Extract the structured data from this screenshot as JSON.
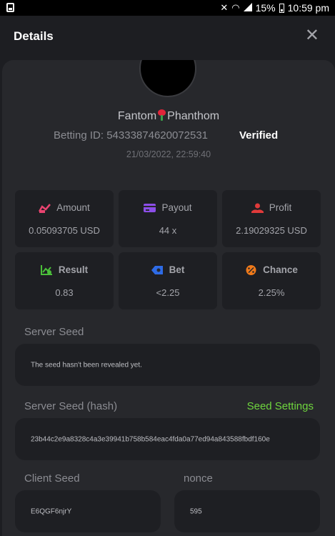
{
  "statusbar": {
    "battery": "15%",
    "time": "10:59 pm"
  },
  "header": {
    "title": "Details",
    "close_symbol": "✕"
  },
  "user": {
    "name_part1": "Fantom",
    "name_part2": "Phanthom",
    "betting_id": "Betting ID: 54333874620072531",
    "verified": "Verified",
    "datetime": "21/03/2022, 22:59:40"
  },
  "stats": {
    "amount": {
      "label": "Amount",
      "value": "0.05093705 USD",
      "color": "#e8436f"
    },
    "payout": {
      "label": "Payout",
      "value": "44 x",
      "color": "#8c4ee8"
    },
    "profit": {
      "label": "Profit",
      "value": "2.19029325 USD",
      "color": "#e03a3a"
    },
    "result": {
      "label": "Result",
      "value": "0.83",
      "color": "#4bbf3a"
    },
    "bet": {
      "label": "Bet",
      "value": "<2.25",
      "color": "#2e6be6"
    },
    "chance": {
      "label": "Chance",
      "value": "2.25%",
      "color": "#f07a1a"
    }
  },
  "server_seed": {
    "label": "Server Seed",
    "value": "The seed hasn't been revealed yet."
  },
  "server_seed_hash": {
    "label": "Server Seed (hash)",
    "link": "Seed Settings",
    "value": "23b44c2e9a8328c4a3e39941b758b584eac4fda0a77ed94a843588fbdf160e"
  },
  "client_seed": {
    "label": "Client Seed",
    "value": "E6QGF6njrY"
  },
  "nonce": {
    "label": "nonce",
    "value": "595"
  }
}
